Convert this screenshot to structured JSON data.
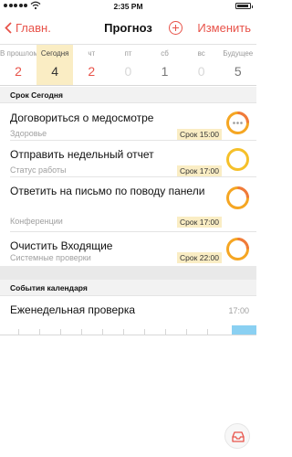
{
  "status_bar": {
    "time": "2:35 PM"
  },
  "nav": {
    "back_label": "Главн.",
    "title": "Прогноз",
    "edit_label": "Изменить",
    "accent_color": "#e8534a"
  },
  "days": [
    {
      "name": "В прошлом",
      "count": "2",
      "count_color": "#e8534a",
      "selected": false
    },
    {
      "name": "Сегодня",
      "count": "4",
      "count_color": "#333333",
      "selected": true
    },
    {
      "name": "чт",
      "count": "2",
      "count_color": "#e8534a",
      "selected": false
    },
    {
      "name": "пт",
      "count": "0",
      "count_color": "#d8d8d8",
      "selected": false
    },
    {
      "name": "сб",
      "count": "1",
      "count_color": "#777777",
      "selected": false
    },
    {
      "name": "вс",
      "count": "0",
      "count_color": "#d8d8d8",
      "selected": false
    },
    {
      "name": "Будущее",
      "count": "5",
      "count_color": "#777777",
      "selected": false
    }
  ],
  "due_section": {
    "header": "Срок Сегодня",
    "tasks": [
      {
        "title": "Договориться о медосмотре",
        "context": "Здоровье",
        "due": "Срок 15:00",
        "ring": "dots"
      },
      {
        "title": "Отправить недельный отчет",
        "context": "Статус работы",
        "due": "Срок 17:00",
        "ring": "plain"
      },
      {
        "title": "Ответить на письмо по поводу панели",
        "context": "Конференции",
        "due": "Срок 17:00",
        "ring": "flag"
      },
      {
        "title": "Очистить Входящие",
        "context": "Системные проверки",
        "due": "Срок 22:00",
        "ring": "flag"
      }
    ]
  },
  "calendar_section": {
    "header": "События календаря",
    "event": {
      "title": "Еженедельная проверка",
      "time": "17:00"
    }
  },
  "colors": {
    "due_highlight": "#faedc4",
    "ring_orange": "#f5a623",
    "ring_red": "#f07a3b",
    "event_bar": "#8ad0f2"
  }
}
